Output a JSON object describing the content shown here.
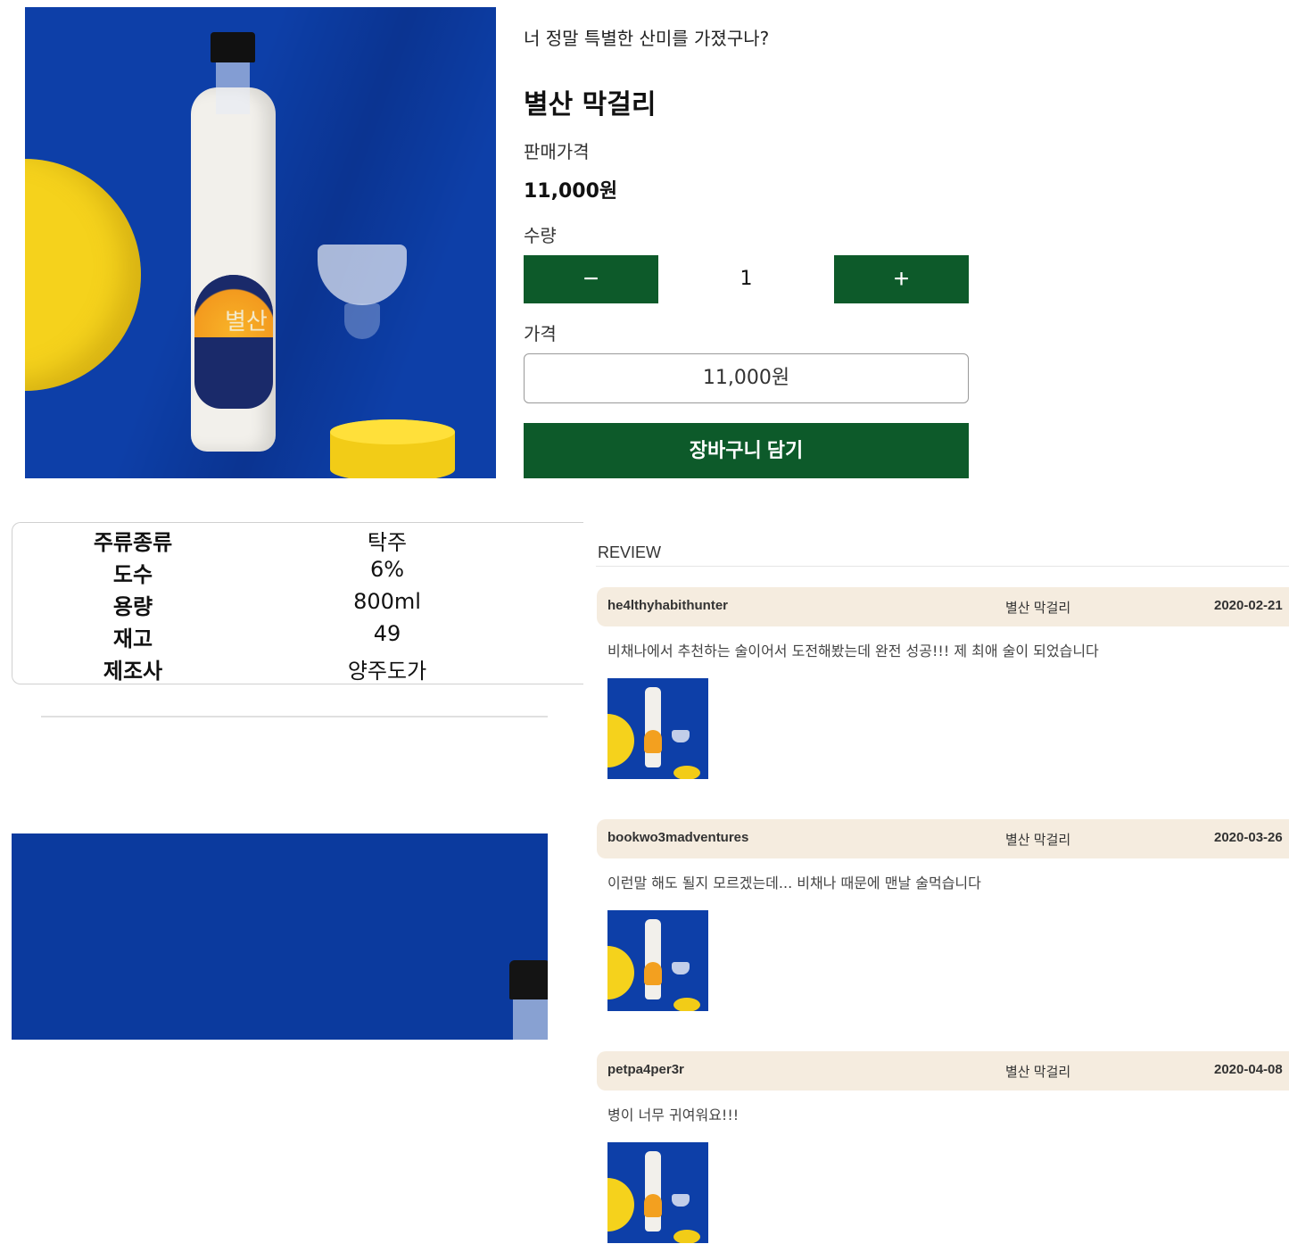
{
  "product": {
    "tagline": "너 정말 특별한 산미를 가졌구나?",
    "name": "별산 막걸리",
    "price_label": "판매가격",
    "price": "11,000원",
    "quantity_label": "수량",
    "quantity": "1",
    "minus_label": "−",
    "plus_label": "+",
    "total_label": "가격",
    "total": "11,000원",
    "cart_button": "장바구니 담기",
    "photo_label_text": "별산"
  },
  "specs": [
    {
      "key": "주류종류",
      "value": "탁주"
    },
    {
      "key": "도수",
      "value": "6%"
    },
    {
      "key": "용량",
      "value": "800ml"
    },
    {
      "key": "재고",
      "value": "49"
    },
    {
      "key": "제조사",
      "value": "양주도가"
    }
  ],
  "reviews": {
    "title": "REVIEW",
    "items": [
      {
        "user": "he4lthyhabithunter",
        "product": "별산 막걸리",
        "date": "2020-02-21",
        "text": "비채나에서 추천하는 술이어서 도전해봤는데 완전 성공!!! 제 최애 술이 되었습니다"
      },
      {
        "user": "bookwo3madventures",
        "product": "별산 막걸리",
        "date": "2020-03-26",
        "text": "이런말 해도 될지 모르겠는데... 비채나 때문에 맨날 술먹습니다"
      },
      {
        "user": "petpa4per3r",
        "product": "별산 막걸리",
        "date": "2020-04-08",
        "text": "병이 너무 귀여워요!!!"
      }
    ]
  },
  "colors": {
    "accent_green": "#0d5a2a",
    "photo_blue": "#0d3fa8",
    "review_header_bg": "#f5ecdf"
  }
}
